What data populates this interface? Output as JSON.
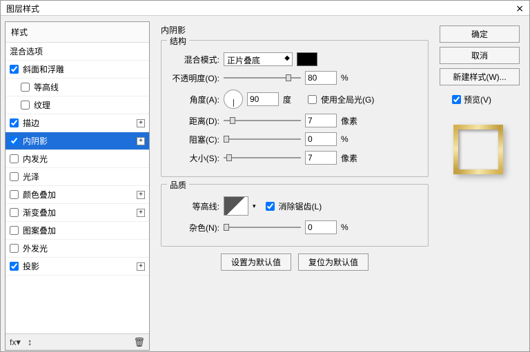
{
  "window": {
    "title": "图层样式",
    "close": "⨯"
  },
  "left": {
    "header": "样式",
    "items": [
      {
        "label": "混合选项",
        "hasCheck": false,
        "checked": false,
        "indent": false
      },
      {
        "label": "斜面和浮雕",
        "hasCheck": true,
        "checked": true,
        "indent": false
      },
      {
        "label": "等高线",
        "hasCheck": true,
        "checked": false,
        "indent": true
      },
      {
        "label": "纹理",
        "hasCheck": true,
        "checked": false,
        "indent": true
      },
      {
        "label": "描边",
        "hasCheck": true,
        "checked": true,
        "indent": false,
        "plus": true
      },
      {
        "label": "内阴影",
        "hasCheck": true,
        "checked": true,
        "indent": false,
        "plus": true,
        "selected": true
      },
      {
        "label": "内发光",
        "hasCheck": true,
        "checked": false,
        "indent": false
      },
      {
        "label": "光泽",
        "hasCheck": true,
        "checked": false,
        "indent": false
      },
      {
        "label": "颜色叠加",
        "hasCheck": true,
        "checked": false,
        "indent": false,
        "plus": true
      },
      {
        "label": "渐变叠加",
        "hasCheck": true,
        "checked": false,
        "indent": false,
        "plus": true
      },
      {
        "label": "图案叠加",
        "hasCheck": true,
        "checked": false,
        "indent": false
      },
      {
        "label": "外发光",
        "hasCheck": true,
        "checked": false,
        "indent": false
      },
      {
        "label": "投影",
        "hasCheck": true,
        "checked": true,
        "indent": false,
        "plus": true
      }
    ],
    "footer": {
      "fx": "fx",
      "arrows": "↕",
      "trash": "🗑"
    }
  },
  "panel": {
    "title": "内阴影",
    "structure": {
      "legend": "结构",
      "blendMode": {
        "label": "混合模式:",
        "value": "正片叠底"
      },
      "opacity": {
        "label": "不透明度(O):",
        "value": "80",
        "unit": "%",
        "pos": 80
      },
      "angle": {
        "label": "角度(A):",
        "value": "90",
        "unit": "度"
      },
      "globalLight": {
        "label": "使用全局光(G)",
        "checked": false
      },
      "distance": {
        "label": "距离(D):",
        "value": "7",
        "unit": "像素",
        "pos": 8
      },
      "choke": {
        "label": "阻塞(C):",
        "value": "0",
        "unit": "%",
        "pos": 0
      },
      "size": {
        "label": "大小(S):",
        "value": "7",
        "unit": "像素",
        "pos": 4
      }
    },
    "quality": {
      "legend": "品质",
      "contour": {
        "label": "等高线:"
      },
      "antiAlias": {
        "label": "消除锯齿(L)",
        "checked": true
      },
      "noise": {
        "label": "杂色(N):",
        "value": "0",
        "unit": "%",
        "pos": 0
      }
    },
    "buttons": {
      "setDefault": "设置为默认值",
      "resetDefault": "复位为默认值"
    }
  },
  "right": {
    "ok": "确定",
    "cancel": "取消",
    "newStyle": "新建样式(W)...",
    "preview": {
      "label": "预览(V)",
      "checked": true
    }
  }
}
